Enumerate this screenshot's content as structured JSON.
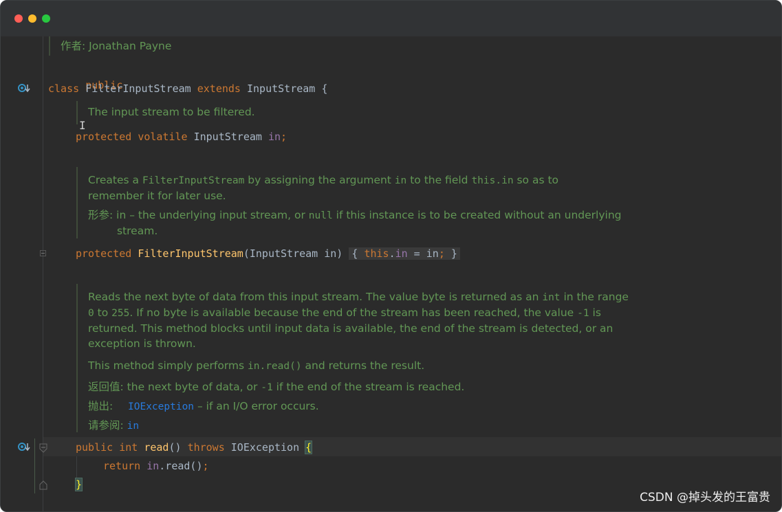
{
  "window": {
    "controls": [
      "close",
      "minimize",
      "zoom"
    ]
  },
  "author_doc": {
    "label": "作者:",
    "value": "Jonathan Payne"
  },
  "class_decl": {
    "modifier": "public",
    "kw_class": "class",
    "name": "FilterInputStream",
    "kw_extends": "extends",
    "parent": "InputStream",
    "open": " {"
  },
  "field_doc": "The input stream to be filtered.",
  "field_decl": {
    "mod1": "protected",
    "mod2": "volatile",
    "type": "InputStream",
    "name": "in",
    "semi": ";"
  },
  "ctor_doc": {
    "p1_a": "Creates a ",
    "p1_code1": "FilterInputStream",
    "p1_b": " by assigning the argument ",
    "p1_code2": "in",
    "p1_c": " to the field ",
    "p1_code3": "this.in",
    "p1_d": " so as to",
    "p1_line2": "remember it for later use.",
    "param_label": "形参:",
    "param_a": "in – the underlying input stream, or ",
    "param_code": "null",
    "param_b": " if this instance is to be created without an underlying",
    "param_line2": "stream."
  },
  "ctor_decl": {
    "mod": "protected",
    "name": "FilterInputStream",
    "params": "(InputStream in)",
    "body_open": "{ ",
    "this_kw": "this",
    "dot": ".",
    "field": "in",
    "assign": " = in",
    "semi": ";",
    "body_close": " }"
  },
  "read_doc": {
    "l1_a": "Reads the next byte of data from this input stream. The value byte is returned as an ",
    "l1_code": "int",
    "l1_b": " in the range",
    "l2_code1": "0",
    "l2_a": " to ",
    "l2_code2": "255",
    "l2_b": ". If no byte is available because the end of the stream has been reached, the value ",
    "l2_code3": "-1",
    "l2_c": " is",
    "l3": "returned. This method blocks until input data is available, the end of the stream is detected, or an",
    "l4": "exception is thrown.",
    "p2_a": "This method simply performs ",
    "p2_code": "in.read()",
    "p2_b": " and returns the result.",
    "returns_label": "返回值:",
    "returns_a": "the next byte of data, or ",
    "returns_code": "-1",
    "returns_b": " if the end of the stream is reached.",
    "throws_label": "抛出:",
    "throws_link": "IOException",
    "throws_b": " – if an I/O error occurs.",
    "see_label": "请参阅:",
    "see_link": "in"
  },
  "read_decl": {
    "mod": "public",
    "type": "int",
    "name": "read",
    "params": "()",
    "throws_kw": "throws",
    "exc": "IOException",
    "brace": "{"
  },
  "read_body": {
    "kw": "return",
    "field": "in",
    "call": ".read()",
    "semi": ";"
  },
  "close_brace": "}",
  "watermark": "CSDN @掉头发的王富贵",
  "colors": {
    "keyword": "#cc7832",
    "method": "#ffc66d",
    "field": "#9876aa",
    "doc": "#629755",
    "link": "#287bde",
    "background": "#2b2b2b"
  },
  "gutter_icons": [
    "override-down-icon",
    "override-down-icon",
    "fold-icon"
  ]
}
